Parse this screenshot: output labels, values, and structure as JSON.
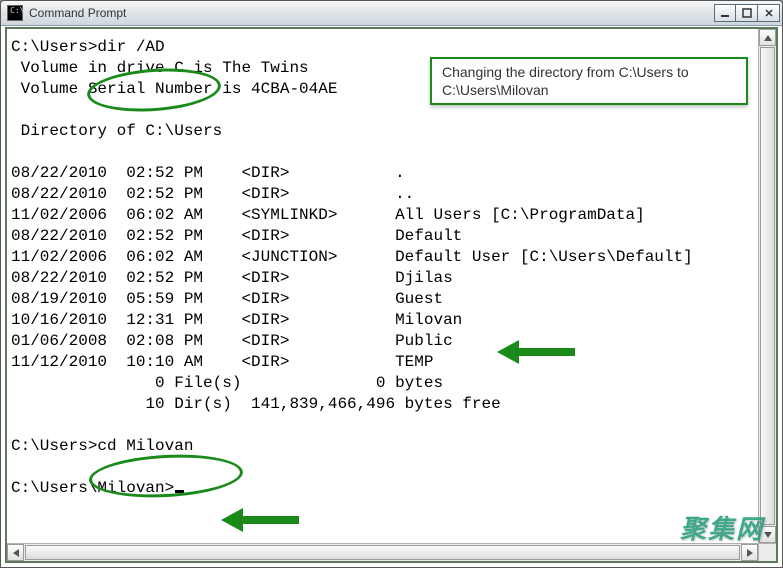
{
  "window": {
    "title": "Command Prompt"
  },
  "annotation": {
    "note": "Changing the directory from C:\\Users to C:\\Users\\Milovan"
  },
  "terminal": {
    "prompt1": "C:\\Users>",
    "cmd1": "dir /AD",
    "vol_line": " Volume in drive C is The Twins",
    "serial_line": " Volume Serial Number is 4CBA-04AE",
    "dir_of": " Directory of C:\\Users",
    "entries": [
      {
        "date": "08/22/2010",
        "time": "02:52 PM",
        "type": "<DIR>",
        "name": "."
      },
      {
        "date": "08/22/2010",
        "time": "02:52 PM",
        "type": "<DIR>",
        "name": ".."
      },
      {
        "date": "11/02/2006",
        "time": "06:02 AM",
        "type": "<SYMLINKD>",
        "name": "All Users [C:\\ProgramData]"
      },
      {
        "date": "08/22/2010",
        "time": "02:52 PM",
        "type": "<DIR>",
        "name": "Default"
      },
      {
        "date": "11/02/2006",
        "time": "06:02 AM",
        "type": "<JUNCTION>",
        "name": "Default User [C:\\Users\\Default]"
      },
      {
        "date": "08/22/2010",
        "time": "02:52 PM",
        "type": "<DIR>",
        "name": "Djilas"
      },
      {
        "date": "08/19/2010",
        "time": "05:59 PM",
        "type": "<DIR>",
        "name": "Guest"
      },
      {
        "date": "10/16/2010",
        "time": "12:31 PM",
        "type": "<DIR>",
        "name": "Milovan"
      },
      {
        "date": "01/06/2008",
        "time": "02:08 PM",
        "type": "<DIR>",
        "name": "Public"
      },
      {
        "date": "11/12/2010",
        "time": "10:10 AM",
        "type": "<DIR>",
        "name": "TEMP"
      }
    ],
    "summary_files": "               0 File(s)              0 bytes",
    "summary_dirs": "              10 Dir(s)  141,839,466,496 bytes free",
    "prompt2": "C:\\Users>",
    "cmd2": "cd Milovan",
    "prompt3": "C:\\Users\\Milovan>"
  },
  "watermark": "聚集网"
}
